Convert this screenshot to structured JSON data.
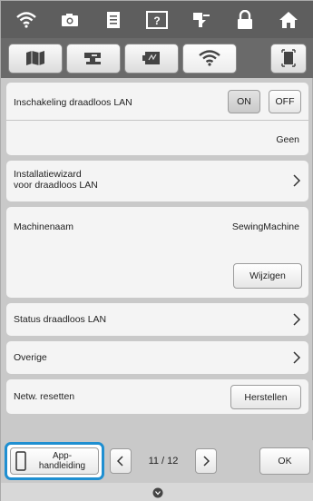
{
  "topbar": {
    "icons": [
      "wifi-icon",
      "camera-icon",
      "document-icon",
      "help-icon",
      "embroidery-icon",
      "lock-icon",
      "home-icon"
    ]
  },
  "tabs": {
    "icons": [
      "map-icon",
      "sewing-machine-icon",
      "embroidery-frame-icon",
      "wifi-icon",
      "screen-icon"
    ],
    "active": 3
  },
  "settings": {
    "wlan_enable": {
      "label": "Inschakeling draadloos LAN",
      "on_label": "ON",
      "off_label": "OFF",
      "selected": "ON"
    },
    "network": {
      "value": "Geen"
    },
    "wizard": {
      "line1": "Installatiewizard",
      "line2": "voor draadloos LAN"
    },
    "machine_name": {
      "label": "Machinenaam",
      "value": "SewingMachine",
      "change_label": "Wijzigen"
    },
    "status": {
      "label": "Status draadloos LAN"
    },
    "other": {
      "label": "Overige"
    },
    "reset": {
      "label": "Netw. resetten",
      "button_label": "Herstellen"
    }
  },
  "bottom": {
    "app_line1": "App-",
    "app_line2": "handleiding",
    "page": "11 / 12",
    "ok_label": "OK"
  },
  "colors": {
    "highlight": "#1f8fd1",
    "bar": "#5e5e5e"
  }
}
